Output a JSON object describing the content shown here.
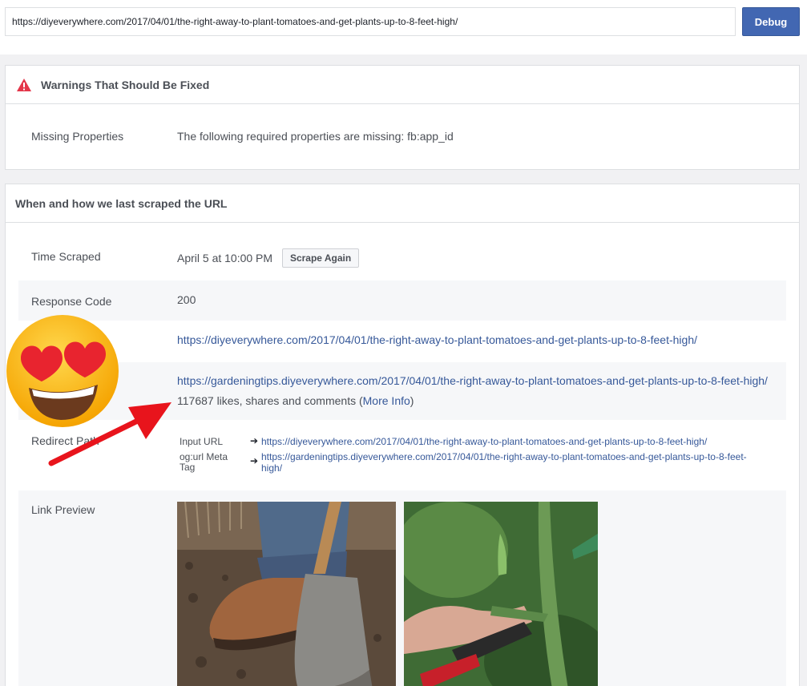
{
  "toolbar": {
    "url_value": "https://diyeverywhere.com/2017/04/01/the-right-away-to-plant-tomatoes-and-get-plants-up-to-8-feet-high/",
    "debug_label": "Debug"
  },
  "warnings": {
    "title": "Warnings That Should Be Fixed",
    "row_label": "Missing Properties",
    "row_value": "The following required properties are missing: fb:app_id"
  },
  "scrape": {
    "title": "When and how we last scraped the URL",
    "time_label": "Time Scraped",
    "time_value": "April 5 at 10:00 PM",
    "scrape_again_label": "Scrape Again",
    "response_label": "Response Code",
    "response_value": "200",
    "fetched_url": "https://diyeverywhere.com/2017/04/01/the-right-away-to-plant-tomatoes-and-get-plants-up-to-8-feet-high/",
    "canonical_url": "https://gardeningtips.diyeverywhere.com/2017/04/01/the-right-away-to-plant-tomatoes-and-get-plants-up-to-8-feet-high/",
    "engagement_text": "117687 likes, shares and comments (",
    "more_info_label": "More Info",
    "engagement_close": ")",
    "redirect_label": "Redirect Path",
    "redirect_input_label": "Input URL",
    "redirect_input_url": "https://diyeverywhere.com/2017/04/01/the-right-away-to-plant-tomatoes-and-get-plants-up-to-8-feet-high/",
    "redirect_og_label_1": "og:url Meta",
    "redirect_og_label_2": "Tag",
    "redirect_og_url_1": "https://gardeningtips.diyeverywhere.com/2017/04/01/the-right-away-to-plant-tomatoes-and-get-plants-up-to-8-feet-",
    "redirect_og_url_2": "high/",
    "arrow_glyph": "➔",
    "preview_label": "Link Preview"
  },
  "colors": {
    "accent": "#4267b2",
    "link": "#365899",
    "warning": "#e4364a",
    "annotation_arrow": "#e8141c"
  }
}
